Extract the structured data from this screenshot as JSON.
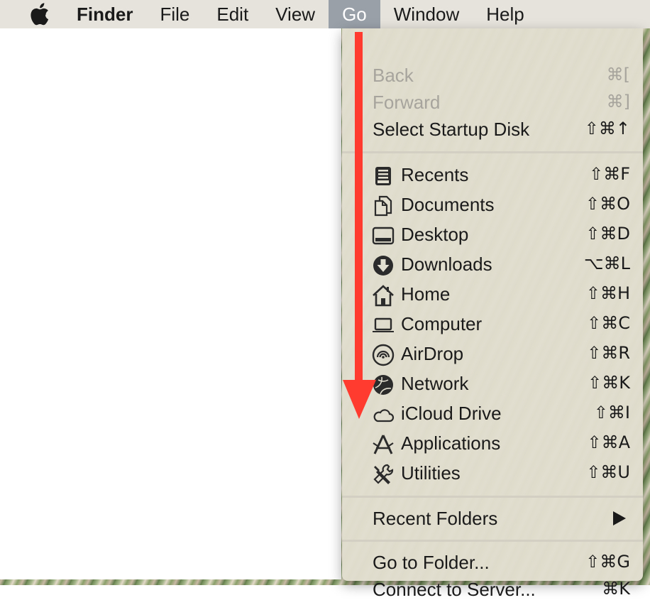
{
  "menubar": {
    "items": [
      "Finder",
      "File",
      "Edit",
      "View",
      "Go",
      "Window",
      "Help"
    ],
    "active": "Go"
  },
  "go_menu": {
    "nav": [
      {
        "label": "Back",
        "shortcut": "⌘[",
        "enabled": false
      },
      {
        "label": "Forward",
        "shortcut": "⌘]",
        "enabled": false
      },
      {
        "label": "Select Startup Disk",
        "shortcut": "⇧⌘↑",
        "enabled": true
      }
    ],
    "places": [
      {
        "label": "Recents",
        "shortcut": "⇧⌘F",
        "icon": "recents-icon"
      },
      {
        "label": "Documents",
        "shortcut": "⇧⌘O",
        "icon": "documents-icon"
      },
      {
        "label": "Desktop",
        "shortcut": "⇧⌘D",
        "icon": "desktop-icon"
      },
      {
        "label": "Downloads",
        "shortcut": "⌥⌘L",
        "icon": "downloads-icon"
      },
      {
        "label": "Home",
        "shortcut": "⇧⌘H",
        "icon": "home-icon"
      },
      {
        "label": "Computer",
        "shortcut": "⇧⌘C",
        "icon": "computer-icon"
      },
      {
        "label": "AirDrop",
        "shortcut": "⇧⌘R",
        "icon": "airdrop-icon"
      },
      {
        "label": "Network",
        "shortcut": "⇧⌘K",
        "icon": "network-icon"
      },
      {
        "label": "iCloud Drive",
        "shortcut": "⇧⌘I",
        "icon": "icloud-icon"
      },
      {
        "label": "Applications",
        "shortcut": "⇧⌘A",
        "icon": "applications-icon"
      },
      {
        "label": "Utilities",
        "shortcut": "⇧⌘U",
        "icon": "utilities-icon"
      }
    ],
    "recent_folders": {
      "label": "Recent Folders"
    },
    "footer": [
      {
        "label": "Go to Folder...",
        "shortcut": "⇧⌘G"
      },
      {
        "label": "Connect to Server...",
        "shortcut": "⌘K"
      }
    ]
  },
  "colors": {
    "menubar_bg": "#e6e3dc",
    "active_menu_bg": "#9aa0a8",
    "menu_bg": "#e2ded0",
    "disabled_text": "#a6a49c",
    "annotation_arrow": "#ff3b30"
  }
}
